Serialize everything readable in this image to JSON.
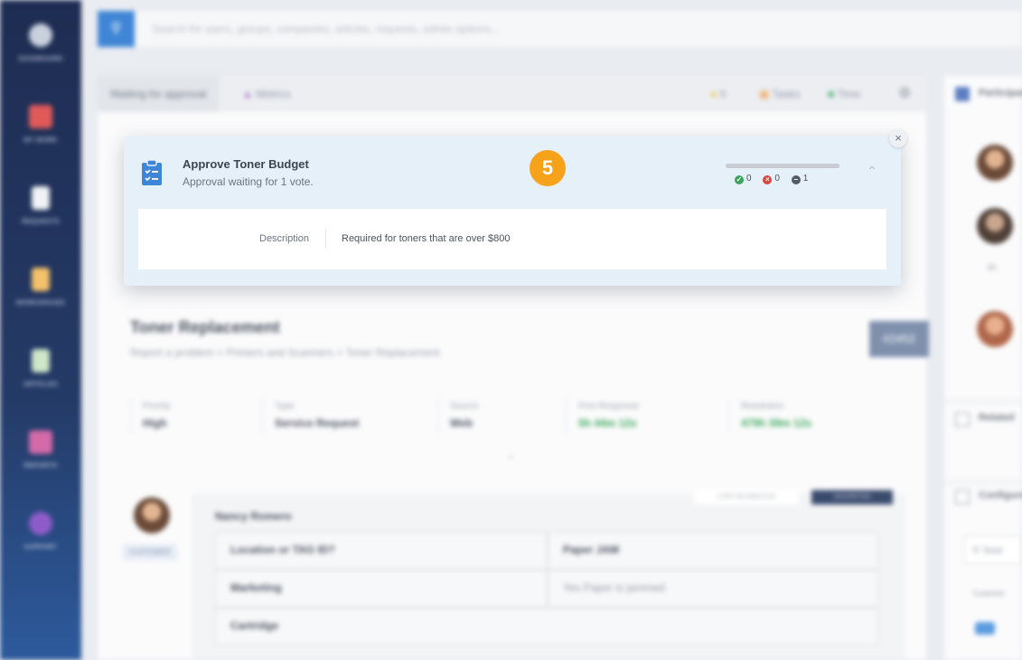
{
  "sidebar": {
    "items": [
      {
        "label": "DASHBOARD",
        "icon": "gauge-icon"
      },
      {
        "label": "MY WORK",
        "icon": "work-list-icon"
      },
      {
        "label": "REQUESTS",
        "icon": "document-icon"
      },
      {
        "label": "WORKSPACES",
        "icon": "lock-document-icon"
      },
      {
        "label": "ARTICLES",
        "icon": "article-icon"
      },
      {
        "label": "REPORTS",
        "icon": "chart-icon"
      },
      {
        "label": "SUPPORT",
        "icon": "support-icon"
      }
    ]
  },
  "search": {
    "placeholder": "Search for users, groups, companies, articles, requests, admin options..."
  },
  "tabs": {
    "waiting": "Waiting for approval",
    "metrics": "Metrics",
    "count": "0",
    "tasks": "Tasks",
    "time": "Time"
  },
  "ticket": {
    "title": "Toner Replacement",
    "breadcrumb": "Report a problem  >  Printers and Scanners  >  Toner Replacement",
    "number": "#2452",
    "meta": [
      {
        "label": "Priority",
        "value": "High"
      },
      {
        "label": "Type",
        "value": "Service Request"
      },
      {
        "label": "Source",
        "value": "Web"
      },
      {
        "label": "First Response",
        "value": "5h 44m 12s"
      },
      {
        "label": "Resolution",
        "value": "479h 39m 12s"
      }
    ]
  },
  "thread": {
    "author": "Nancy Romero",
    "role_tag": "CUSTOMER",
    "btn_left": "A FEW SECONDS AGO",
    "btn_right": "DESCRIPTION",
    "rows": [
      {
        "left": "Location or TAG ID?",
        "right": "Paper JAM"
      },
      {
        "left": "Marketing",
        "right": "Yes Paper is jammed"
      },
      {
        "left": "Cartridge",
        "right": ""
      }
    ]
  },
  "right_panel": {
    "participants": "Participants",
    "related": "Related",
    "configure": "Configure",
    "search_placeholder": "Sear",
    "customer_label": "Customer",
    "zoom_label": "m"
  },
  "approval": {
    "title": "Approve Toner Budget",
    "subtitle": "Approval waiting for 1 vote.",
    "step": "5",
    "votes": {
      "approved": "0",
      "rejected": "0",
      "pending": "1"
    },
    "description_label": "Description",
    "description_value": "Required for toners that are over $800",
    "close": "×",
    "collapse": "⌃"
  },
  "colors": {
    "accent": "#3f86d6",
    "step_badge": "#f7a21b",
    "approved": "#3aa55a",
    "rejected": "#d9443b",
    "pending": "#555b66"
  }
}
